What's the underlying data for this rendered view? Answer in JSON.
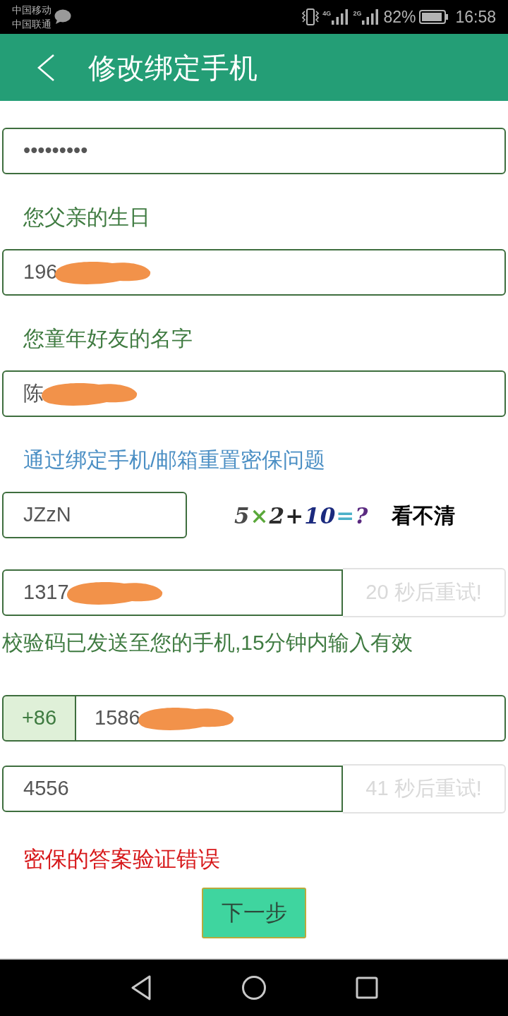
{
  "status_bar": {
    "carriers": [
      "中国移动",
      "中国联通"
    ],
    "networks": [
      "4G",
      "2G"
    ],
    "battery": "82%",
    "time": "16:58"
  },
  "header": {
    "title": "修改绑定手机"
  },
  "form": [
    {
      "kind": "input",
      "value": "•••••••••",
      "redacted": false
    },
    {
      "kind": "label",
      "text": "您父亲的生日"
    },
    {
      "kind": "input",
      "value": "196",
      "redacted": true
    },
    {
      "kind": "label",
      "text": "您童年好友的名字"
    },
    {
      "kind": "input",
      "value": "陈",
      "redacted": true
    },
    {
      "kind": "link",
      "text": "通过绑定手机/邮箱重置密保问题"
    },
    {
      "kind": "captcha",
      "value": "JZzN",
      "image_text": "5×2+10=?",
      "refresh": "看不清"
    },
    {
      "kind": "code",
      "value": "1317",
      "redacted": true,
      "button": "20 秒后重试!",
      "disabled": true
    },
    {
      "kind": "hint",
      "text": "校验码已发送至您的手机,15分钟内输入有效"
    },
    {
      "kind": "phone",
      "prefix": "+86",
      "value": "1586",
      "redacted": true
    },
    {
      "kind": "code",
      "value": "4556",
      "redacted": false,
      "button": "41 秒后重试!",
      "disabled": true
    },
    {
      "kind": "error",
      "text": "密保的答案验证错误"
    }
  ],
  "submit": {
    "label": "下一步"
  }
}
